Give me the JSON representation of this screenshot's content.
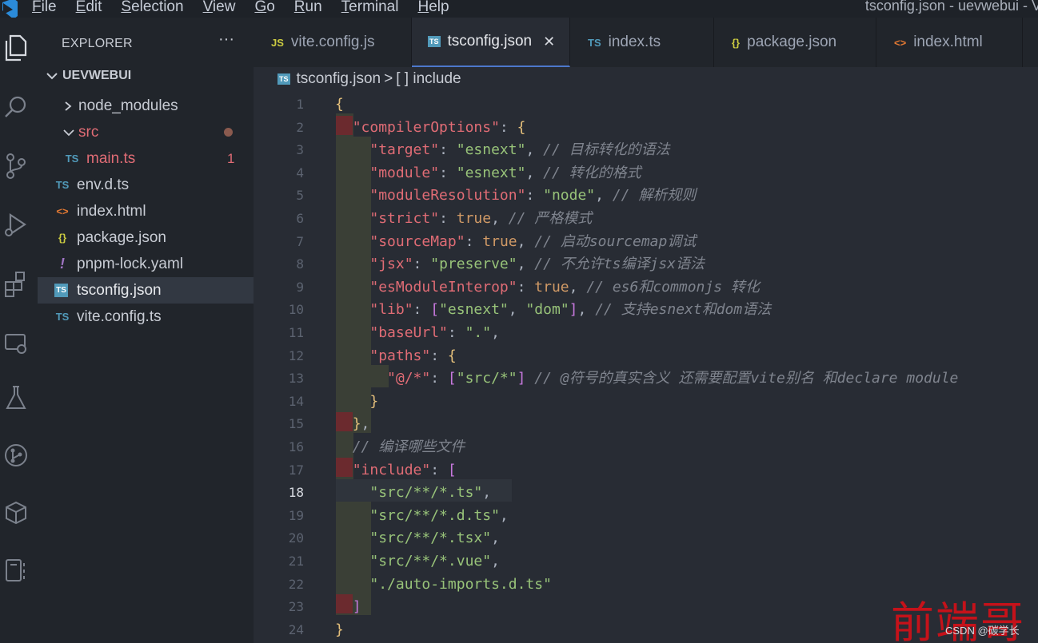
{
  "window_title": "tsconfig.json - uevwebui - V",
  "menu": [
    "File",
    "Edit",
    "Selection",
    "View",
    "Go",
    "Run",
    "Terminal",
    "Help"
  ],
  "explorer": {
    "header": "EXPLORER",
    "dots": "···",
    "root_folder": "UEVWEBUI",
    "items": [
      {
        "label": "node_modules",
        "icon": "chevron-right-icon",
        "glyph": ">"
      },
      {
        "label": "src",
        "icon": "chevron-down-icon",
        "glyph": "v"
      },
      {
        "label": "main.ts",
        "icon": "ts-file-icon",
        "glyph": "TS",
        "badge": "1"
      },
      {
        "label": "env.d.ts",
        "icon": "ts-file-icon",
        "glyph": "TS"
      },
      {
        "label": "index.html",
        "icon": "html-file-icon",
        "glyph": "<>"
      },
      {
        "label": "package.json",
        "icon": "json-file-icon",
        "glyph": "{}"
      },
      {
        "label": "pnpm-lock.yaml",
        "icon": "yaml-file-icon",
        "glyph": "!"
      },
      {
        "label": "tsconfig.json",
        "icon": "ts-file-icon",
        "glyph": "TS"
      },
      {
        "label": "vite.config.ts",
        "icon": "ts-file-icon",
        "glyph": "TS"
      }
    ]
  },
  "tabs": [
    {
      "label": "vite.config.js",
      "icon": "js-file-icon",
      "glyph": "JS"
    },
    {
      "label": "tsconfig.json",
      "icon": "ts-file-icon",
      "glyph": "TS",
      "close": "✕"
    },
    {
      "label": "index.ts",
      "icon": "ts-file-icon",
      "glyph": "TS"
    },
    {
      "label": "package.json",
      "icon": "json-file-icon",
      "glyph": "{}"
    },
    {
      "label": "index.html",
      "icon": "html-file-icon",
      "glyph": "<>"
    }
  ],
  "breadcrumb": {
    "file": "tsconfig.json",
    "sep": ">",
    "item": "[ ] include"
  },
  "current_line": 18,
  "code_lines": [
    "{",
    "  \"compilerOptions\": {",
    "    \"target\": \"esnext\", // 目标转化的语法",
    "    \"module\": \"esnext\", // 转化的格式",
    "    \"moduleResolution\": \"node\", // 解析规则",
    "    \"strict\": true, // 严格模式",
    "    \"sourceMap\": true, // 启动sourcemap调试",
    "    \"jsx\": \"preserve\", // 不允许ts编译jsx语法",
    "    \"esModuleInterop\": true, // es6和commonjs 转化",
    "    \"lib\": [\"esnext\", \"dom\"], // 支持esnext和dom语法",
    "    \"baseUrl\": \".\",",
    "    \"paths\": {",
    "      \"@/*\": [\"src/*\"] // @符号的真实含义 还需要配置vite别名 和declare module",
    "    }",
    "  },",
    "  // 编译哪些文件",
    "  \"include\": [",
    "    \"src/**/*.ts\",",
    "    \"src/**/*.d.ts\",",
    "    \"src/**/*.tsx\",",
    "    \"src/**/*.vue\",",
    "    \"./auto-imports.d.ts\"",
    "  ]",
    "}"
  ],
  "watermark": {
    "main": "前端哥",
    "small": "CSDN @碳学长"
  },
  "colors": {
    "key": "#e06c75",
    "string": "#98c379",
    "comment": "#7f848e",
    "bool": "#d19a66",
    "accent": "#4d78cc"
  }
}
